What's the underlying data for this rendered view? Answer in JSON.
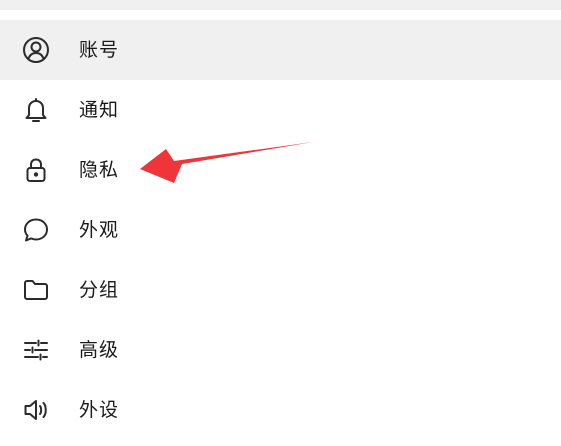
{
  "menu": {
    "items": [
      {
        "label": "账号",
        "icon": "user-circle-icon",
        "active": true
      },
      {
        "label": "通知",
        "icon": "bell-icon",
        "active": false
      },
      {
        "label": "隐私",
        "icon": "lock-icon",
        "active": false
      },
      {
        "label": "外观",
        "icon": "chat-bubble-icon",
        "active": false
      },
      {
        "label": "分组",
        "icon": "folder-icon",
        "active": false
      },
      {
        "label": "高级",
        "icon": "sliders-icon",
        "active": false
      },
      {
        "label": "外设",
        "icon": "speaker-icon",
        "active": false
      }
    ]
  },
  "annotation": {
    "color": "#f0353a",
    "target": "隐私"
  }
}
